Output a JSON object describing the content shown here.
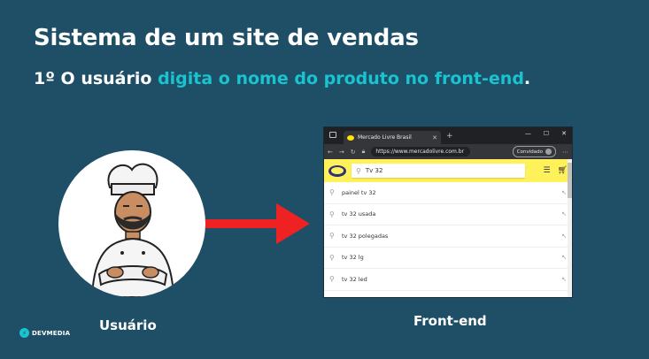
{
  "slide": {
    "title": "Sistema de um site de vendas",
    "subtitle_prefix": "1º O usuário ",
    "subtitle_highlight": "digita o nome do produto no front-end",
    "subtitle_suffix": ".",
    "highlight_color": "#19c3cf",
    "background_color": "#1f4f66"
  },
  "user": {
    "label": "Usuário",
    "icon": "chef-avatar-icon"
  },
  "frontend": {
    "label": "Front-end"
  },
  "arrow": {
    "color": "#ee2222",
    "icon": "arrow-right-icon"
  },
  "browser": {
    "tab_title": "Mercado Livre Brasil",
    "url": "https://www.mercadolivre.com.br",
    "incognito_label": "Convidado",
    "search_value": "Tv 32",
    "suggestions": [
      "painel tv 32",
      "tv 32 usada",
      "tv 32 polegadas",
      "tv 32 lg",
      "tv 32 led"
    ]
  },
  "brand": {
    "name": "DEVMEDIA"
  }
}
